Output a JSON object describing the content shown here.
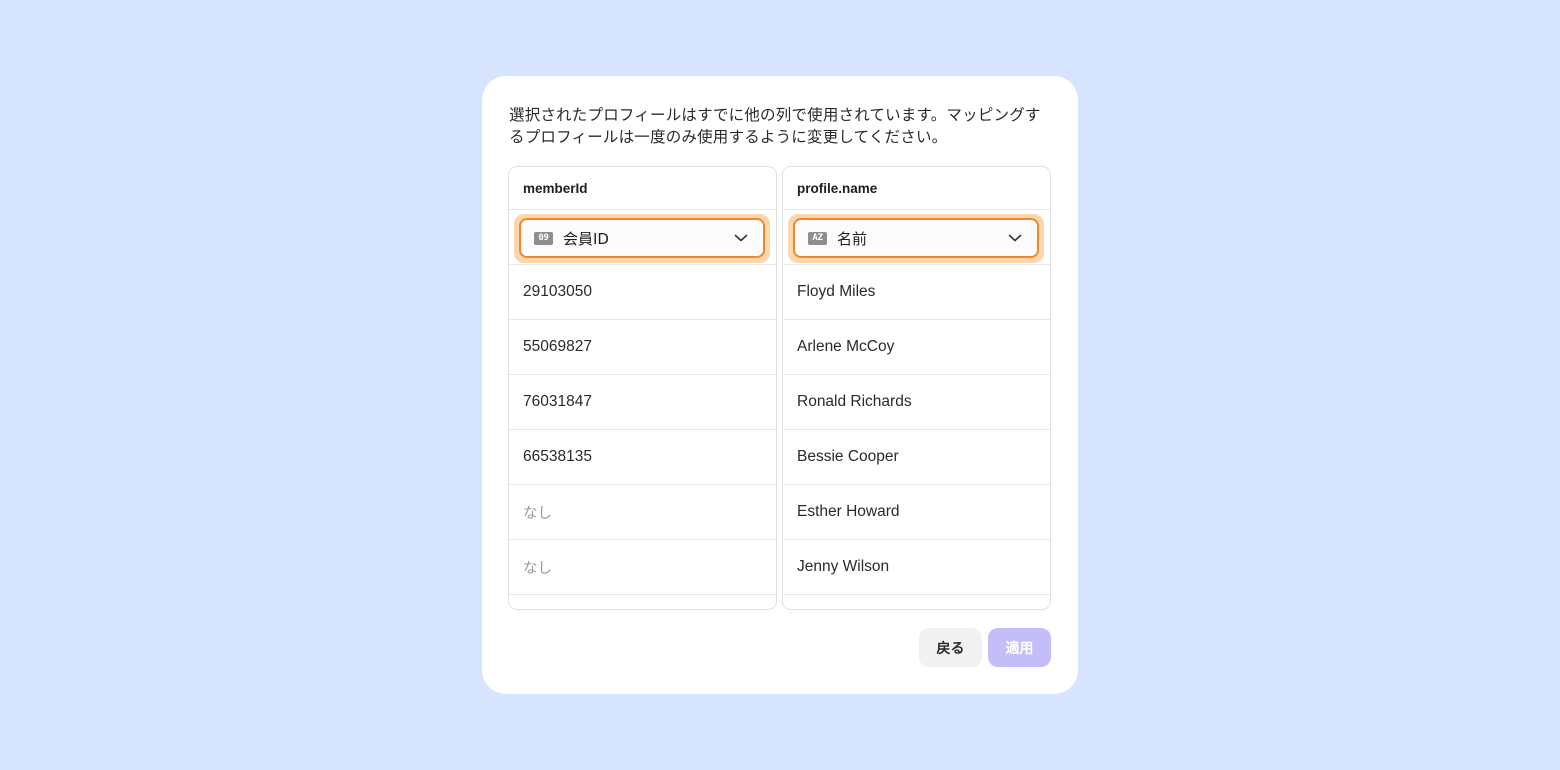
{
  "dialog": {
    "message": "選択されたプロフィールはすでに他の列で使用されています。マッピングするプロフィールは一度のみ使用するように変更してください。",
    "columns": [
      {
        "header": "memberId",
        "select": {
          "type_badge": "09",
          "value": "会員ID",
          "icon": "chevron-down-icon"
        },
        "rows": [
          "29103050",
          "55069827",
          "76031847",
          "66538135",
          "なし",
          "なし"
        ]
      },
      {
        "header": "profile.name",
        "select": {
          "type_badge": "AZ",
          "value": "名前",
          "icon": "chevron-down-icon"
        },
        "rows": [
          "Floyd Miles",
          "Arlene McCoy",
          "Ronald Richards",
          "Bessie Cooper",
          "Esther Howard",
          "Jenny Wilson"
        ]
      }
    ],
    "buttons": {
      "back_label": "戻る",
      "apply_label": "適用",
      "apply_disabled": true
    }
  },
  "colors": {
    "background": "#d6e4fd",
    "error_border": "#f2882c",
    "error_ring": "#fcd6ad",
    "apply_disabled": "#c3bdf8"
  }
}
